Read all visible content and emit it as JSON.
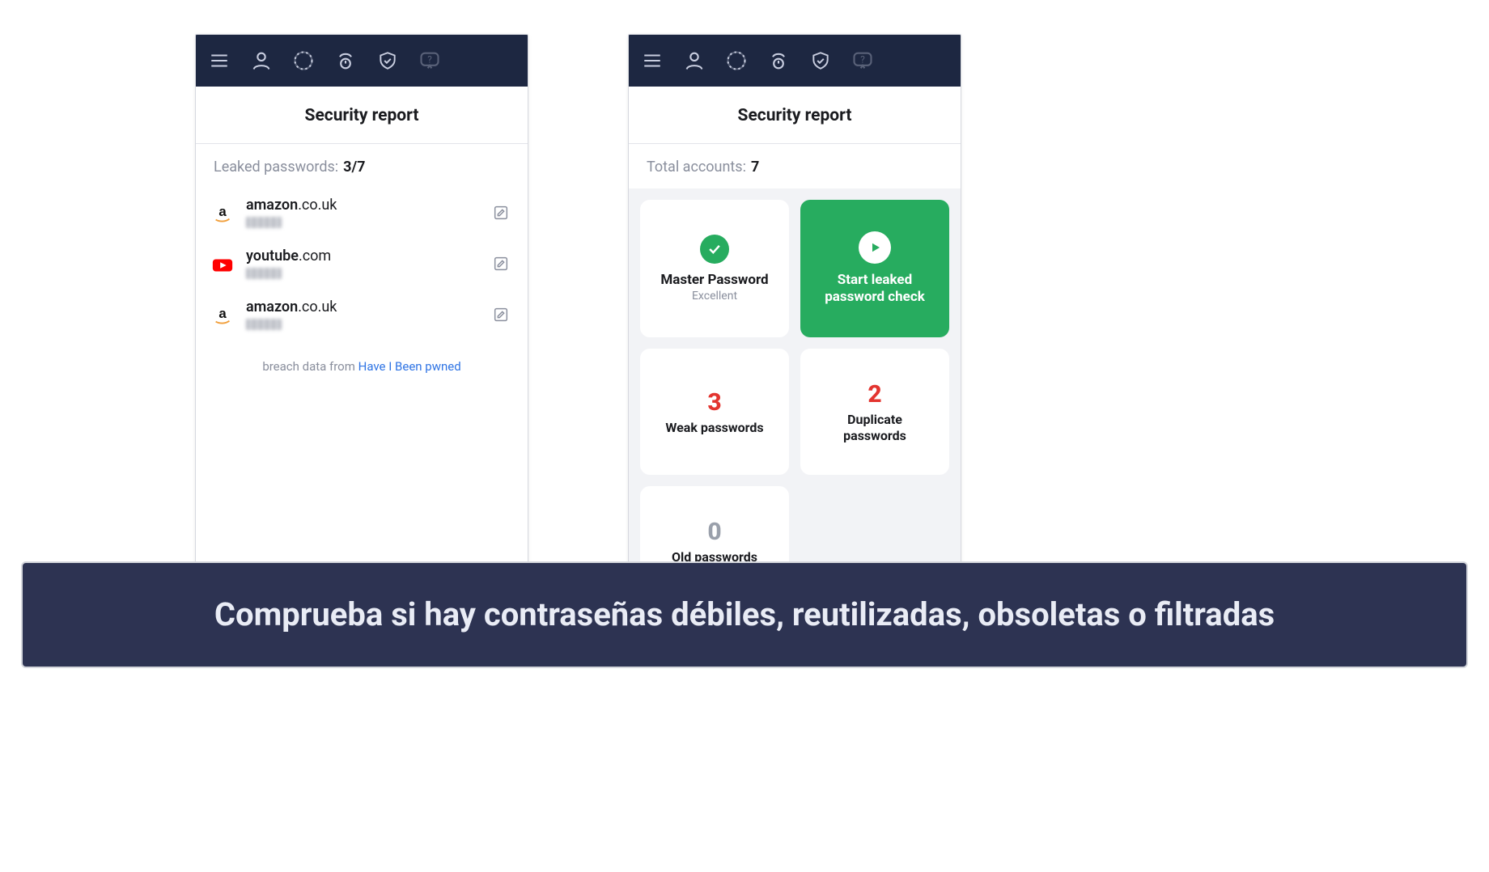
{
  "page_title": "Security report",
  "left": {
    "subtitle_label": "Leaked passwords:",
    "subtitle_value": "3/7",
    "items": [
      {
        "site_main": "amazon",
        "site_tld": ".co.uk",
        "icon": "amazon"
      },
      {
        "site_main": "youtube",
        "site_tld": ".com",
        "icon": "youtube"
      },
      {
        "site_main": "amazon",
        "site_tld": ".co.uk",
        "icon": "amazon"
      }
    ],
    "breach_prefix": "breach data from ",
    "breach_link": "Have I Been pwned"
  },
  "right": {
    "subtitle_label": "Total accounts:",
    "subtitle_value": "7",
    "cards": {
      "master": {
        "title": "Master Password",
        "sub": "Excellent"
      },
      "action": {
        "label_line1": "Start leaked",
        "label_line2": "password check"
      },
      "weak": {
        "count": "3",
        "label": "Weak passwords"
      },
      "dup": {
        "count": "2",
        "label_line1": "Duplicate",
        "label_line2": "passwords"
      },
      "old": {
        "count": "0",
        "label": "Old passwords"
      }
    }
  },
  "caption": "Comprueba si hay contraseñas débiles, reutilizadas, obsoletas o filtradas",
  "colors": {
    "nav_bg": "#1d2741",
    "action_green": "#27ac5f",
    "danger_red": "#e3342f",
    "grey_text": "#8a8f9d"
  }
}
